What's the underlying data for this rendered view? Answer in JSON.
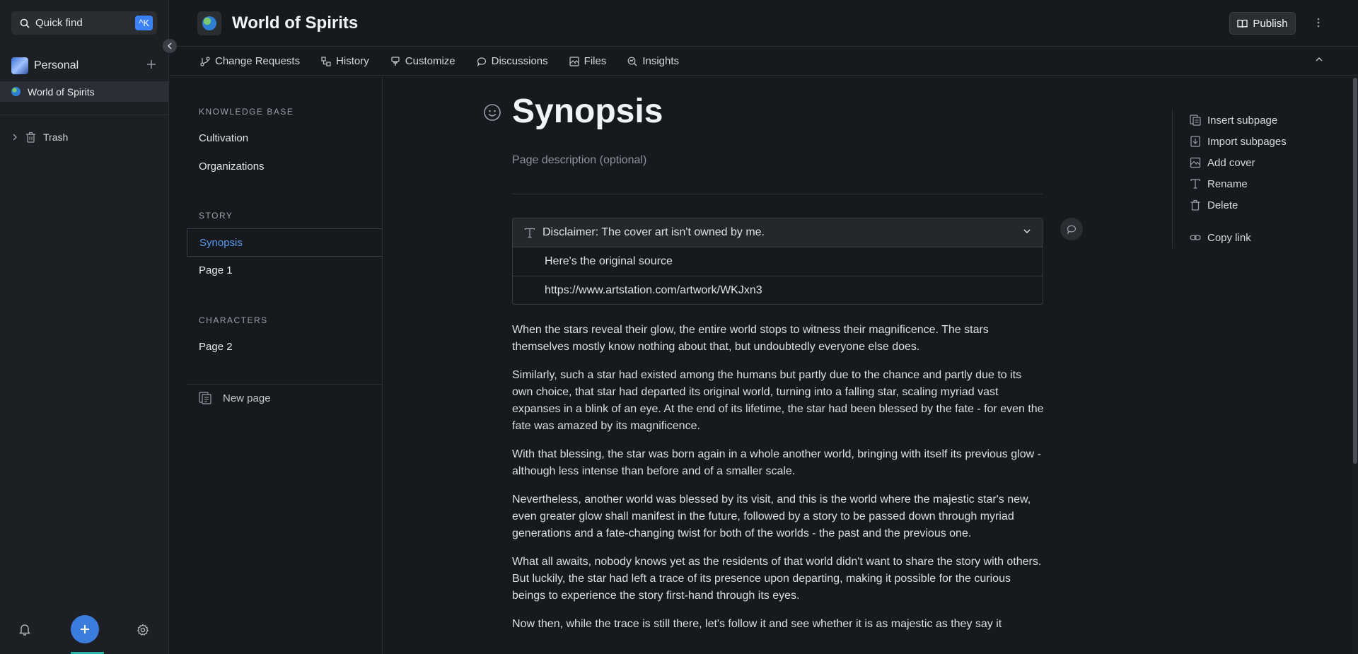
{
  "sidebar": {
    "quick_find": "Quick find",
    "shortcut": "^K",
    "space_name": "Personal",
    "site_name": "World of Spirits",
    "trash": "Trash"
  },
  "header": {
    "title": "World of Spirits",
    "publish": "Publish"
  },
  "tabs": [
    {
      "label": "Change Requests",
      "icon": "branch-icon"
    },
    {
      "label": "History",
      "icon": "history-icon"
    },
    {
      "label": "Customize",
      "icon": "brush-icon"
    },
    {
      "label": "Discussions",
      "icon": "chat-icon"
    },
    {
      "label": "Files",
      "icon": "image-icon"
    },
    {
      "label": "Insights",
      "icon": "insights-icon"
    }
  ],
  "pagetree": {
    "sections": [
      {
        "label": "KNOWLEDGE BASE",
        "items": [
          "Cultivation",
          "Organizations"
        ]
      },
      {
        "label": "STORY",
        "items": [
          "Synopsis",
          "Page 1"
        ]
      },
      {
        "label": "CHARACTERS",
        "items": [
          "Page 2"
        ]
      }
    ],
    "active": "Synopsis",
    "new_page": "New page"
  },
  "page": {
    "title": "Synopsis",
    "description_placeholder": "Page description (optional)",
    "expandable": {
      "title": "Disclaimer: The cover art isn't owned by me.",
      "rows": [
        "Here's the original source",
        "https://www.artstation.com/artwork/WKJxn3"
      ]
    },
    "paragraphs": [
      "When the stars reveal their glow, the entire world stops to witness their magnificence. The stars themselves mostly know nothing about that, but undoubtedly everyone else does.",
      "Similarly, such a star had existed among the humans but partly due to the chance and partly due to its own choice, that star had departed its original world, turning into a falling star, scaling myriad vast expanses in a blink of an eye. At the end of its lifetime, the star had been blessed by the fate - for even the fate was amazed by its magnificence.",
      "With that blessing, the star was born again in a whole another world, bringing with itself its previous glow - although less intense than before and of a smaller scale.",
      "Nevertheless, another world was blessed by its visit, and this is the world where the majestic star's new, even greater glow shall manifest in the future, followed by a story to be passed down through myriad generations and a fate-changing twist for both of the worlds - the past and the previous one.",
      "What all awaits, nobody knows yet as the residents of that world didn't want to share the story with others. But luckily, the star had left a trace of its presence upon departing, making it possible for the curious beings to experience the story first-hand through its eyes.",
      "Now then, while the trace is still there, let's follow it and see whether it is as majestic as they say it"
    ]
  },
  "actions": [
    {
      "label": "Insert subpage",
      "icon": "insert-subpage-icon"
    },
    {
      "label": "Import subpages",
      "icon": "import-icon"
    },
    {
      "label": "Add cover",
      "icon": "cover-icon"
    },
    {
      "label": "Rename",
      "icon": "text-icon"
    },
    {
      "label": "Delete",
      "icon": "trash-icon"
    },
    {
      "label": "Copy link",
      "icon": "link-icon"
    }
  ]
}
